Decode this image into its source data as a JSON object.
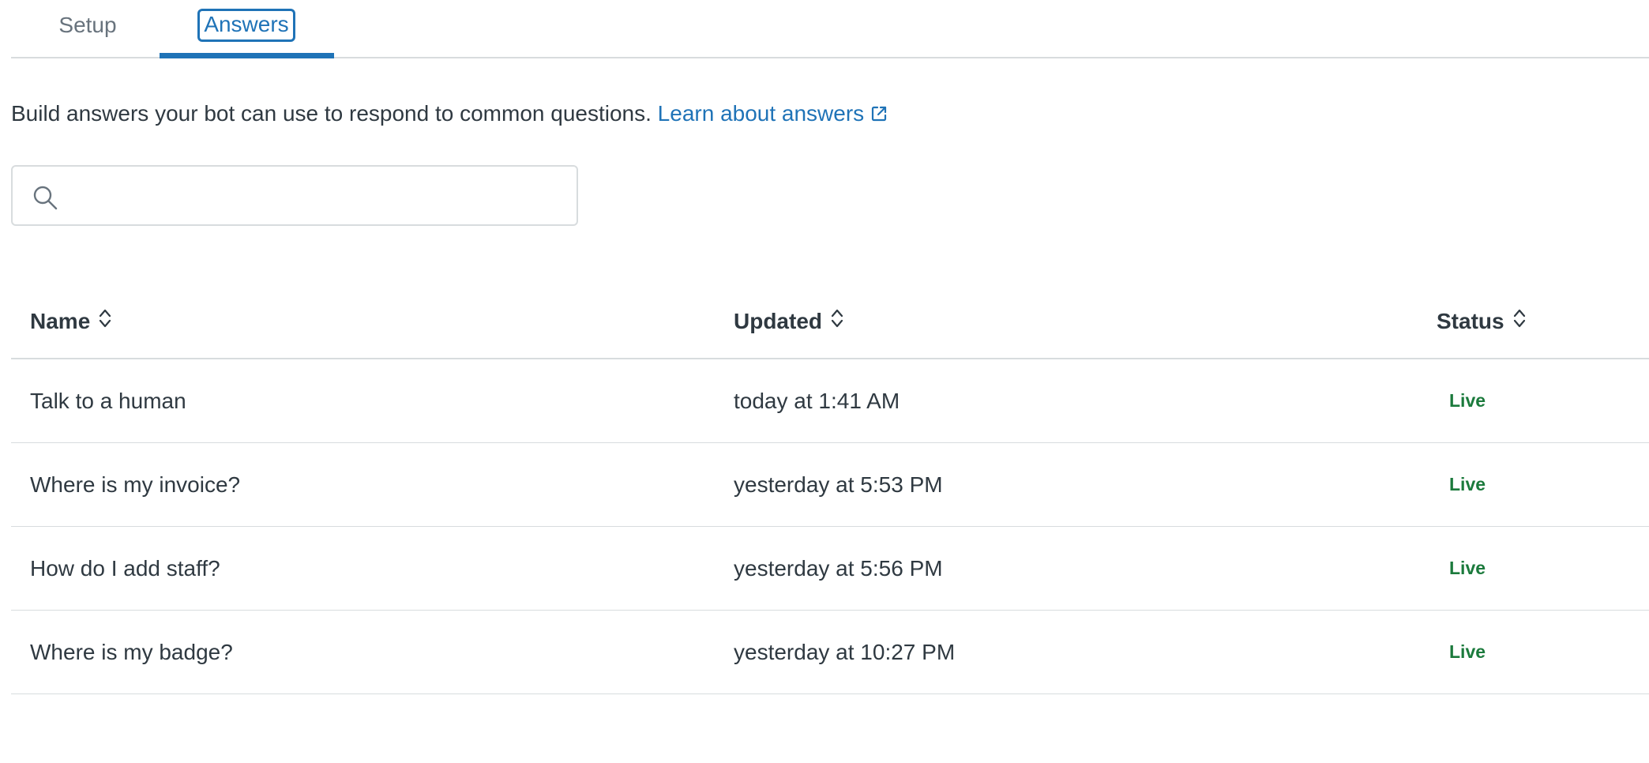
{
  "tabs": [
    {
      "label": "Setup"
    },
    {
      "label": "Answers"
    }
  ],
  "description": {
    "text": "Build answers your bot can use to respond to common questions. ",
    "link_label": "Learn about answers"
  },
  "search": {
    "value": "",
    "placeholder": ""
  },
  "table": {
    "columns": [
      "Name",
      "Updated",
      "Status"
    ],
    "rows": [
      {
        "name": "Talk to a human",
        "updated": "today at 1:41 AM",
        "status": "Live"
      },
      {
        "name": "Where is my invoice?",
        "updated": "yesterday at 5:53 PM",
        "status": "Live"
      },
      {
        "name": "How do I add staff?",
        "updated": "yesterday at 5:56 PM",
        "status": "Live"
      },
      {
        "name": "Where is my badge?",
        "updated": "yesterday at 10:27 PM",
        "status": "Live"
      }
    ]
  },
  "colors": {
    "accent": "#1f73b7",
    "status_live": "#1b7a3c",
    "border": "#d8dcde"
  },
  "icons": {
    "search": "search-icon",
    "external_link": "external-link-icon",
    "sort": "sort-icon"
  }
}
